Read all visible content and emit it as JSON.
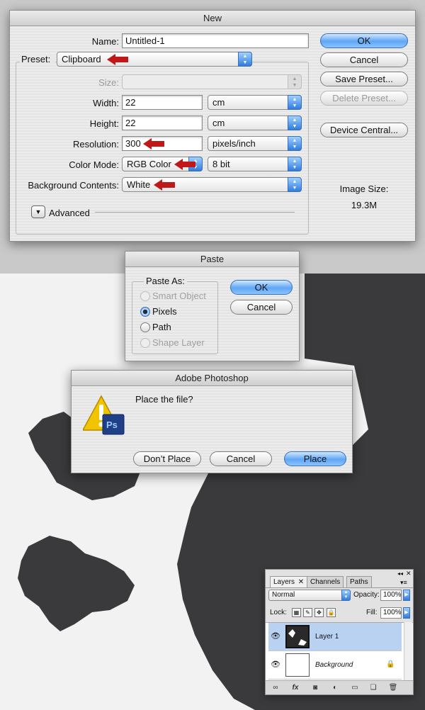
{
  "new_dialog": {
    "title": "New",
    "name_label": "Name:",
    "name_value": "Untitled-1",
    "preset_label": "Preset:",
    "preset_value": "Clipboard",
    "size_label": "Size:",
    "width_label": "Width:",
    "width_value": "22",
    "width_unit": "cm",
    "height_label": "Height:",
    "height_value": "22",
    "height_unit": "cm",
    "resolution_label": "Resolution:",
    "resolution_value": "300",
    "resolution_unit": "pixels/inch",
    "color_mode_label": "Color Mode:",
    "color_mode_value": "RGB Color",
    "bit_depth": "8 bit",
    "background_label": "Background Contents:",
    "background_value": "White",
    "advanced_label": "Advanced",
    "image_size_label": "Image Size:",
    "image_size_value": "19.3M",
    "buttons": {
      "ok": "OK",
      "cancel": "Cancel",
      "save_preset": "Save Preset...",
      "delete_preset": "Delete Preset...",
      "device_central": "Device Central..."
    }
  },
  "paste_dialog": {
    "title": "Paste",
    "group_label": "Paste As:",
    "options": [
      {
        "label": "Smart Object",
        "state": "disabled"
      },
      {
        "label": "Pixels",
        "state": "selected"
      },
      {
        "label": "Path",
        "state": "unselected"
      },
      {
        "label": "Shape Layer",
        "state": "disabled"
      }
    ],
    "ok": "OK",
    "cancel": "Cancel"
  },
  "place_dialog": {
    "title": "Adobe Photoshop",
    "message": "Place the file?",
    "icon_badge": "Ps",
    "dont_place": "Don’t Place",
    "cancel": "Cancel",
    "place": "Place"
  },
  "layers_panel": {
    "tabs": [
      "Layers",
      "Channels",
      "Paths"
    ],
    "blend_mode": "Normal",
    "opacity_label": "Opacity:",
    "opacity_value": "100%",
    "lock_label": "Lock:",
    "fill_label": "Fill:",
    "fill_value": "100%",
    "layers": [
      {
        "name": "Layer 1",
        "selected": true
      },
      {
        "name": "Background",
        "selected": false
      }
    ],
    "footer_fx": "fx"
  },
  "colors": {
    "accent_blue": "#5fa6f5",
    "annotation_red": "#c01818",
    "map_land": "#3a393b"
  }
}
